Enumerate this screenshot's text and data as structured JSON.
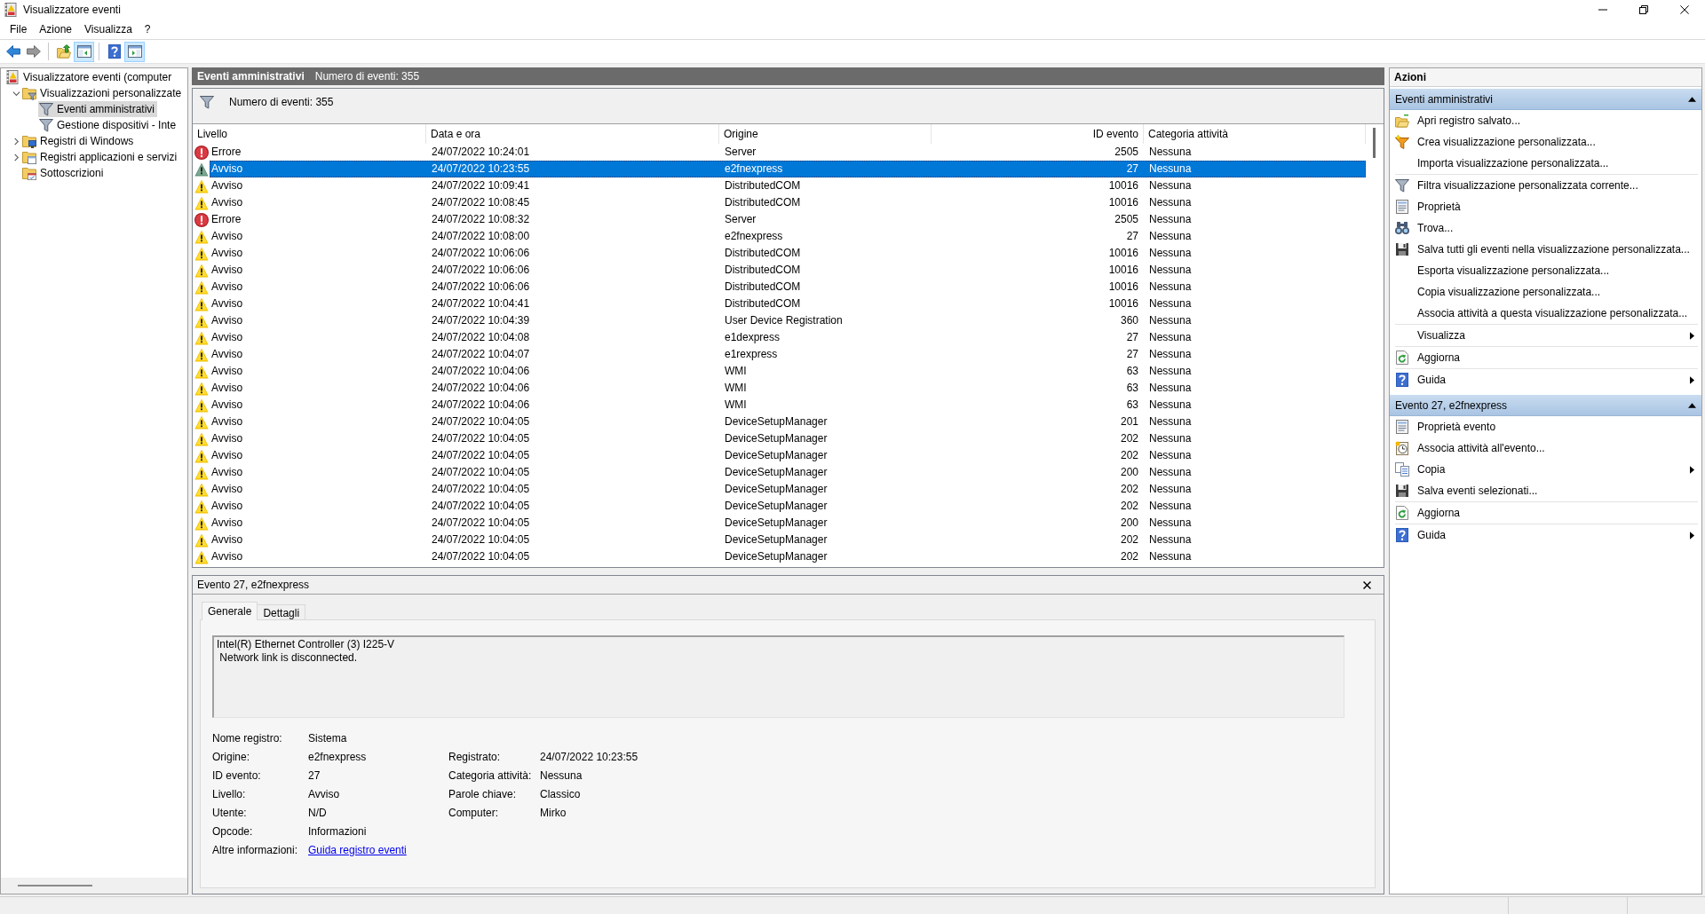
{
  "window": {
    "title": "Visualizzatore eventi"
  },
  "menu": [
    {
      "label": "File"
    },
    {
      "label": "Azione"
    },
    {
      "label": "Visualizza"
    },
    {
      "label": "?"
    }
  ],
  "toolbar": [
    [
      {
        "kind": "back",
        "pressed": false,
        "disabled": false
      },
      {
        "kind": "forward",
        "pressed": false,
        "disabled": true
      }
    ],
    [
      {
        "kind": "up",
        "pressed": false,
        "disabled": false
      },
      {
        "kind": "tree",
        "pressed": true,
        "disabled": false
      }
    ],
    [
      {
        "kind": "help",
        "pressed": false,
        "disabled": false
      },
      {
        "kind": "actions",
        "pressed": true,
        "disabled": false
      }
    ]
  ],
  "tree": [
    {
      "kind": "viewer",
      "label": "Visualizzatore eventi (computer",
      "selected": false,
      "children": [
        {
          "kind": "filterfolder",
          "label": "Visualizzazioni personalizzate",
          "selected": false,
          "expanded": true,
          "children": [
            {
              "kind": "filter",
              "label": "Eventi amministrativi",
              "selected": true
            },
            {
              "kind": "filter",
              "label": "Gestione dispositivi - Inte",
              "selected": false
            }
          ]
        },
        {
          "kind": "logfolder",
          "label": "Registri di Windows",
          "selected": false,
          "expanded": false
        },
        {
          "kind": "appfolder",
          "label": "Registri applicazioni e servizi",
          "selected": false,
          "expanded": false
        },
        {
          "kind": "subfolder",
          "label": "Sottoscrizioni",
          "selected": false
        }
      ]
    }
  ],
  "events_pane": {
    "title": "Eventi amministrativi",
    "count": "Numero di eventi: 355",
    "filter_status": "Numero di eventi: 355"
  },
  "table": {
    "columns": [
      "Livello",
      "Data e ora",
      "Origine",
      "ID evento",
      "Categoria attività"
    ],
    "rows": [
      {
        "kind": "error",
        "severity": "Errore",
        "date": "24/07/2022 10:24:01",
        "source": "Server",
        "event_id": "2505",
        "category": "Nessuna",
        "selected": false
      },
      {
        "kind": "warning",
        "severity": "Avviso",
        "date": "24/07/2022 10:23:55",
        "source": "e2fnexpress",
        "event_id": "27",
        "category": "Nessuna",
        "selected": true
      },
      {
        "kind": "warning",
        "severity": "Avviso",
        "date": "24/07/2022 10:09:41",
        "source": "DistributedCOM",
        "event_id": "10016",
        "category": "Nessuna",
        "selected": false
      },
      {
        "kind": "warning",
        "severity": "Avviso",
        "date": "24/07/2022 10:08:45",
        "source": "DistributedCOM",
        "event_id": "10016",
        "category": "Nessuna",
        "selected": false
      },
      {
        "kind": "error",
        "severity": "Errore",
        "date": "24/07/2022 10:08:32",
        "source": "Server",
        "event_id": "2505",
        "category": "Nessuna",
        "selected": false
      },
      {
        "kind": "warning",
        "severity": "Avviso",
        "date": "24/07/2022 10:08:00",
        "source": "e2fnexpress",
        "event_id": "27",
        "category": "Nessuna",
        "selected": false
      },
      {
        "kind": "warning",
        "severity": "Avviso",
        "date": "24/07/2022 10:06:06",
        "source": "DistributedCOM",
        "event_id": "10016",
        "category": "Nessuna",
        "selected": false
      },
      {
        "kind": "warning",
        "severity": "Avviso",
        "date": "24/07/2022 10:06:06",
        "source": "DistributedCOM",
        "event_id": "10016",
        "category": "Nessuna",
        "selected": false
      },
      {
        "kind": "warning",
        "severity": "Avviso",
        "date": "24/07/2022 10:06:06",
        "source": "DistributedCOM",
        "event_id": "10016",
        "category": "Nessuna",
        "selected": false
      },
      {
        "kind": "warning",
        "severity": "Avviso",
        "date": "24/07/2022 10:04:41",
        "source": "DistributedCOM",
        "event_id": "10016",
        "category": "Nessuna",
        "selected": false
      },
      {
        "kind": "warning",
        "severity": "Avviso",
        "date": "24/07/2022 10:04:39",
        "source": "User Device Registration",
        "event_id": "360",
        "category": "Nessuna",
        "selected": false
      },
      {
        "kind": "warning",
        "severity": "Avviso",
        "date": "24/07/2022 10:04:08",
        "source": "e1dexpress",
        "event_id": "27",
        "category": "Nessuna",
        "selected": false
      },
      {
        "kind": "warning",
        "severity": "Avviso",
        "date": "24/07/2022 10:04:07",
        "source": "e1rexpress",
        "event_id": "27",
        "category": "Nessuna",
        "selected": false
      },
      {
        "kind": "warning",
        "severity": "Avviso",
        "date": "24/07/2022 10:04:06",
        "source": "WMI",
        "event_id": "63",
        "category": "Nessuna",
        "selected": false
      },
      {
        "kind": "warning",
        "severity": "Avviso",
        "date": "24/07/2022 10:04:06",
        "source": "WMI",
        "event_id": "63",
        "category": "Nessuna",
        "selected": false
      },
      {
        "kind": "warning",
        "severity": "Avviso",
        "date": "24/07/2022 10:04:06",
        "source": "WMI",
        "event_id": "63",
        "category": "Nessuna",
        "selected": false
      },
      {
        "kind": "warning",
        "severity": "Avviso",
        "date": "24/07/2022 10:04:05",
        "source": "DeviceSetupManager",
        "event_id": "201",
        "category": "Nessuna",
        "selected": false
      },
      {
        "kind": "warning",
        "severity": "Avviso",
        "date": "24/07/2022 10:04:05",
        "source": "DeviceSetupManager",
        "event_id": "202",
        "category": "Nessuna",
        "selected": false
      },
      {
        "kind": "warning",
        "severity": "Avviso",
        "date": "24/07/2022 10:04:05",
        "source": "DeviceSetupManager",
        "event_id": "202",
        "category": "Nessuna",
        "selected": false
      },
      {
        "kind": "warning",
        "severity": "Avviso",
        "date": "24/07/2022 10:04:05",
        "source": "DeviceSetupManager",
        "event_id": "200",
        "category": "Nessuna",
        "selected": false
      },
      {
        "kind": "warning",
        "severity": "Avviso",
        "date": "24/07/2022 10:04:05",
        "source": "DeviceSetupManager",
        "event_id": "202",
        "category": "Nessuna",
        "selected": false
      },
      {
        "kind": "warning",
        "severity": "Avviso",
        "date": "24/07/2022 10:04:05",
        "source": "DeviceSetupManager",
        "event_id": "202",
        "category": "Nessuna",
        "selected": false
      },
      {
        "kind": "warning",
        "severity": "Avviso",
        "date": "24/07/2022 10:04:05",
        "source": "DeviceSetupManager",
        "event_id": "200",
        "category": "Nessuna",
        "selected": false
      },
      {
        "kind": "warning",
        "severity": "Avviso",
        "date": "24/07/2022 10:04:05",
        "source": "DeviceSetupManager",
        "event_id": "202",
        "category": "Nessuna",
        "selected": false
      },
      {
        "kind": "warning",
        "severity": "Avviso",
        "date": "24/07/2022 10:04:05",
        "source": "DeviceSetupManager",
        "event_id": "202",
        "category": "Nessuna",
        "selected": false
      }
    ]
  },
  "details": {
    "title": "Evento 27, e2fnexpress",
    "tabs": [
      {
        "label": "Generale",
        "selected": true
      },
      {
        "label": "Dettagli",
        "selected": false
      }
    ],
    "description": "Intel(R) Ethernet Controller (3) I225-V\n Network link is disconnected.",
    "fields_left": [
      {
        "label": "Nome registro:",
        "value": "Sistema"
      },
      {
        "label": "Origine:",
        "value": "e2fnexpress"
      },
      {
        "label": "ID evento:",
        "value": "27"
      },
      {
        "label": "Livello:",
        "value": "Avviso"
      },
      {
        "label": "Utente:",
        "value": "N/D"
      },
      {
        "label": "Opcode:",
        "value": "Informazioni"
      }
    ],
    "fields_right": [
      {
        "label": "Registrato:",
        "value": "24/07/2022 10:23:55"
      },
      {
        "label": "Categoria attività:",
        "value": "Nessuna"
      },
      {
        "label": "Parole chiave:",
        "value": "Classico"
      },
      {
        "label": "Computer:",
        "value": "Mirko"
      }
    ],
    "more_info": {
      "label": "Altre informazioni:",
      "link": "Guida registro eventi"
    }
  },
  "actions": {
    "title": "Azioni",
    "sections": [
      {
        "title": "Eventi amministrativi",
        "expanded": true,
        "groups": [
          [
            {
              "kind": "open",
              "label": "Apri registro salvato...",
              "submenu": false
            },
            {
              "kind": "create",
              "label": "Crea visualizzazione personalizzata...",
              "submenu": false
            },
            {
              "kind": "plain",
              "label": "Importa visualizzazione personalizzata...",
              "submenu": false
            }
          ],
          [
            {
              "kind": "filter",
              "label": "Filtra visualizzazione personalizzata corrente...",
              "submenu": false
            },
            {
              "kind": "properties",
              "label": "Proprietà",
              "submenu": false
            },
            {
              "kind": "find",
              "label": "Trova...",
              "submenu": false
            },
            {
              "kind": "save",
              "label": "Salva tutti gli eventi nella visualizzazione personalizzata...",
              "submenu": false
            },
            {
              "kind": "plain",
              "label": "Esporta visualizzazione personalizzata...",
              "submenu": false
            },
            {
              "kind": "plain",
              "label": "Copia visualizzazione personalizzata...",
              "submenu": false
            },
            {
              "kind": "plain",
              "label": "Associa attività a questa visualizzazione personalizzata...",
              "submenu": false
            }
          ],
          [
            {
              "kind": "plain",
              "label": "Visualizza",
              "submenu": true
            }
          ],
          [
            {
              "kind": "refresh",
              "label": "Aggiorna",
              "submenu": false
            }
          ],
          [
            {
              "kind": "help",
              "label": "Guida",
              "submenu": true
            }
          ]
        ]
      },
      {
        "title": "Evento 27, e2fnexpress",
        "expanded": true,
        "groups": [
          [
            {
              "kind": "properties",
              "label": "Proprietà evento",
              "submenu": false
            },
            {
              "kind": "task",
              "label": "Associa attività all'evento...",
              "submenu": false
            },
            {
              "kind": "copy",
              "label": "Copia",
              "submenu": true
            },
            {
              "kind": "save",
              "label": "Salva eventi selezionati...",
              "submenu": false
            }
          ],
          [
            {
              "kind": "refresh",
              "label": "Aggiorna",
              "submenu": false
            }
          ],
          [
            {
              "kind": "help",
              "label": "Guida",
              "submenu": true
            }
          ]
        ]
      }
    ]
  }
}
